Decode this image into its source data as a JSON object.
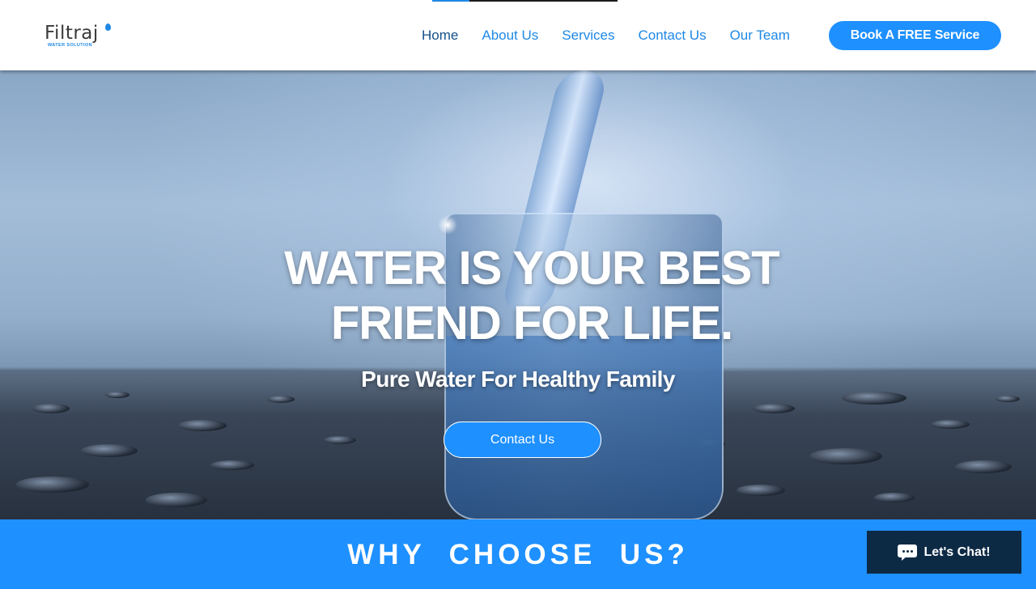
{
  "brand": {
    "name": "Filtraj",
    "tagline": "WATER SOLUTION",
    "accent_color": "#1e90ff",
    "dark_color": "#0d2a45"
  },
  "nav": {
    "items": [
      {
        "label": "Home",
        "active": true
      },
      {
        "label": "About Us",
        "active": false
      },
      {
        "label": "Services",
        "active": false
      },
      {
        "label": "Contact Us",
        "active": false
      },
      {
        "label": "Our Team",
        "active": false
      }
    ],
    "cta_label": "Book A FREE Service"
  },
  "hero": {
    "title_line1": "WATER IS YOUR BEST",
    "title_line2": "FRIEND FOR LIFE.",
    "subtitle": "Pure Water For Healthy Family",
    "button_label": "Contact Us"
  },
  "why": {
    "heading": "WHY  CHOOSE  US?"
  },
  "chat": {
    "label": "Let's Chat!",
    "icon": "chat-bubble-icon"
  }
}
